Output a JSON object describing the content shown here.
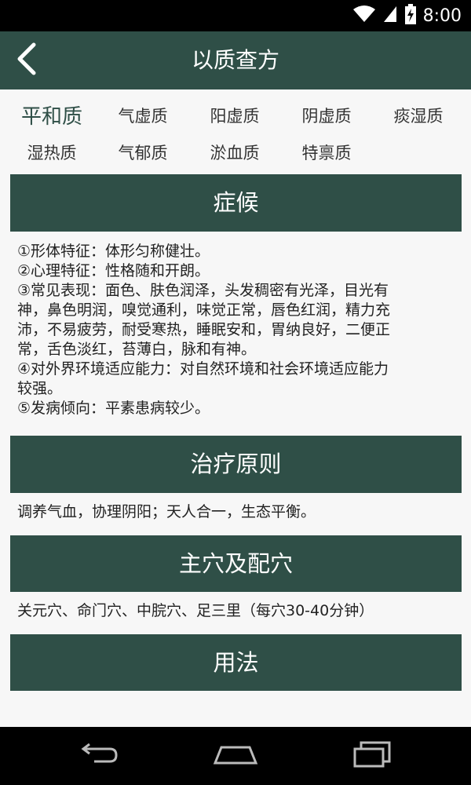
{
  "status_bar": {
    "time": "8:00",
    "icons": [
      "wifi-icon",
      "signal-icon",
      "battery-charging-icon"
    ]
  },
  "app_bar": {
    "title": "以质查方",
    "back_icon": "chevron-left-icon"
  },
  "constitution_tabs": [
    {
      "label": "平和质",
      "active": true
    },
    {
      "label": "气虚质",
      "active": false
    },
    {
      "label": "阳虚质",
      "active": false
    },
    {
      "label": "阴虚质",
      "active": false
    },
    {
      "label": "痰湿质",
      "active": false
    },
    {
      "label": "湿热质",
      "active": false
    },
    {
      "label": "气郁质",
      "active": false
    },
    {
      "label": "淤血质",
      "active": false
    },
    {
      "label": "特禀质",
      "active": false
    }
  ],
  "sections": {
    "symptoms": {
      "title": "症候",
      "lines": [
        "①形体特征：体形匀称健壮。",
        "②心理特征：性格随和开朗。",
        "③常见表现：面色、肤色润泽，头发稠密有光泽，目光有",
        "神，鼻色明润，嗅觉通利，味觉正常，唇色红润，精力充",
        "沛，不易疲劳，耐受寒热，睡眠安和，胃纳良好，二便正",
        "常，舌色淡红，苔薄白，脉和有神。",
        "④对外界环境适应能力：对自然环境和社会环境适应能力",
        "较强。",
        "⑤发病倾向：平素患病较少。"
      ]
    },
    "principle": {
      "title": "治疗原则",
      "text": "调养气血，协理阴阳；天人合一，生态平衡。"
    },
    "acupoints": {
      "title": "主穴及配穴",
      "text": "关元穴、命门穴、中脘穴、足三里（每穴30-40分钟）"
    },
    "usage": {
      "title": "用法"
    }
  },
  "nav_bar": {
    "buttons": [
      "back-nav-icon",
      "home-nav-icon",
      "recent-apps-icon"
    ]
  },
  "colors": {
    "primary": "#2f4f47",
    "background": "#f7f7f7",
    "text": "#222222"
  }
}
